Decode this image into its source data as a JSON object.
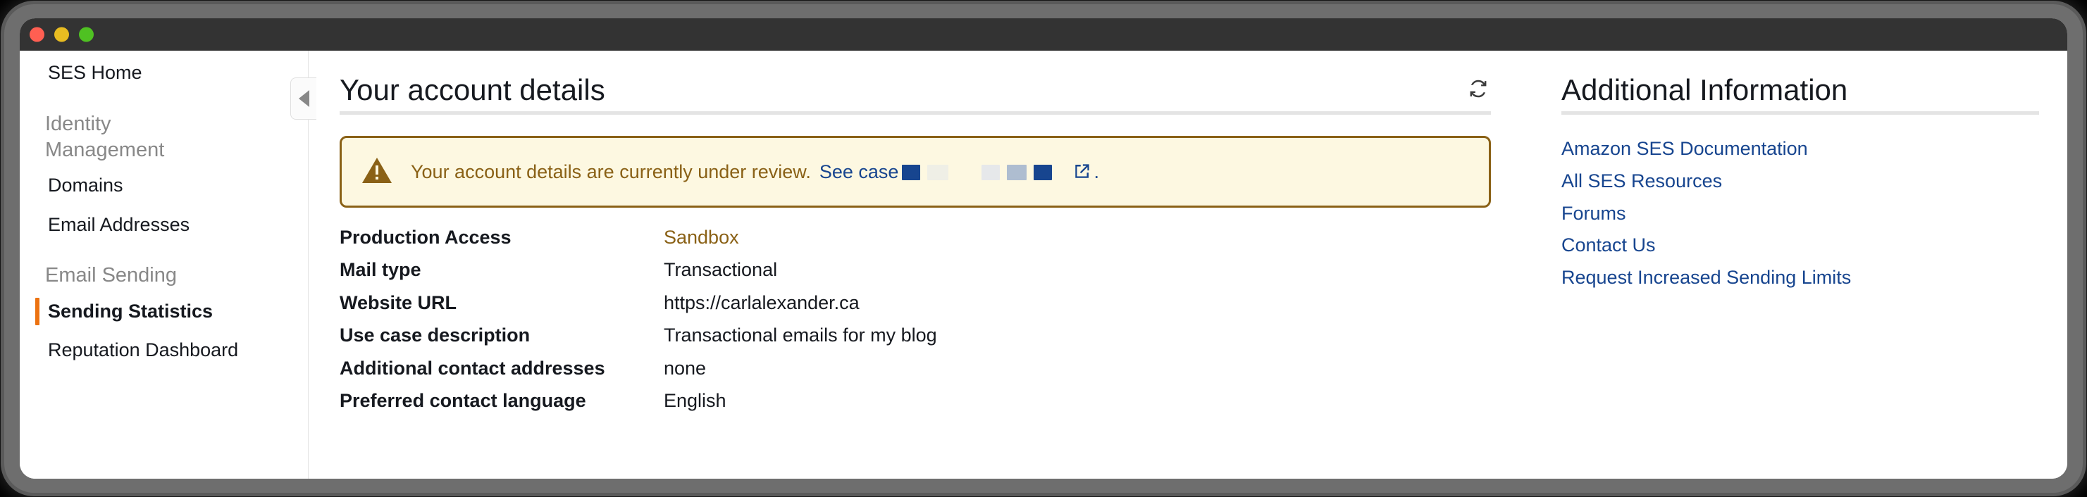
{
  "window": {
    "traffic_lights": [
      "close-red",
      "minimize-yellow",
      "maximize-green"
    ]
  },
  "sidebar": {
    "home_label": "SES Home",
    "collapse_icon": "caret-left-icon",
    "sections": [
      {
        "heading": "Identity Management",
        "items": [
          {
            "label": "Domains",
            "active": false
          },
          {
            "label": "Email Addresses",
            "active": false
          }
        ]
      },
      {
        "heading": "Email Sending",
        "items": [
          {
            "label": "Sending Statistics",
            "active": true
          },
          {
            "label": "Reputation Dashboard",
            "active": false
          }
        ]
      }
    ]
  },
  "main": {
    "title": "Your account details",
    "refresh_icon": "refresh-icon",
    "alert": {
      "icon": "warning-triangle-icon",
      "message": "Your account details are currently under review.",
      "link_label": "See case",
      "redacted_value": "■■ ■■■",
      "external_icon": "external-link-icon",
      "trailing_punctuation": "."
    },
    "details": [
      {
        "label": "Production Access",
        "value": "Sandbox",
        "highlight": true
      },
      {
        "label": "Mail type",
        "value": "Transactional",
        "highlight": false
      },
      {
        "label": "Website URL",
        "value": "https://carlalexander.ca",
        "highlight": false
      },
      {
        "label": "Use case description",
        "value": "Transactional emails for my blog",
        "highlight": false
      },
      {
        "label": "Additional contact addresses",
        "value": "none",
        "highlight": false
      },
      {
        "label": "Preferred contact language",
        "value": "English",
        "highlight": false
      }
    ]
  },
  "aside": {
    "title": "Additional Information",
    "links": [
      "Amazon SES Documentation",
      "All SES Resources",
      "Forums",
      "Contact Us",
      "Request Increased Sending Limits"
    ]
  },
  "colors": {
    "accent_orange": "#ec7211",
    "warning_text": "#8a6116",
    "warning_bg": "#fdf8e1",
    "link_blue": "#17458f",
    "titlebar": "#333333"
  }
}
